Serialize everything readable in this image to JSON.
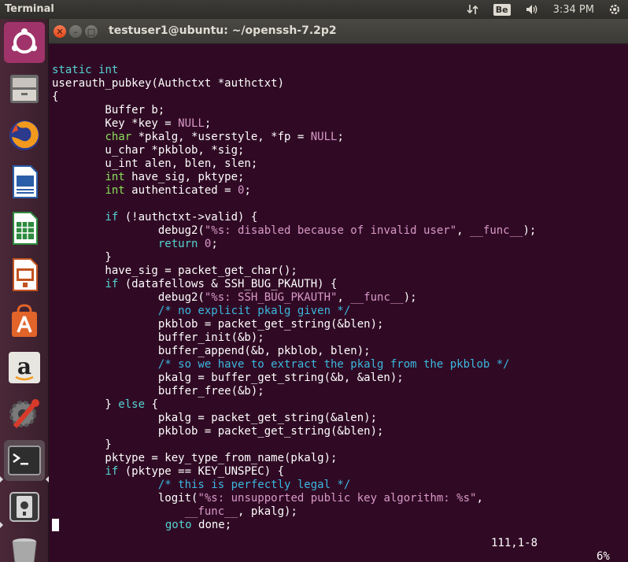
{
  "panel": {
    "app_title": "Terminal",
    "keyboard_layout": "Be",
    "clock": "3:34 PM"
  },
  "launcher": {
    "items": [
      {
        "name": "ubuntu-dash-icon"
      },
      {
        "name": "files-icon"
      },
      {
        "name": "firefox-icon"
      },
      {
        "name": "libreoffice-writer-icon"
      },
      {
        "name": "libreoffice-calc-icon"
      },
      {
        "name": "libreoffice-impress-icon"
      },
      {
        "name": "ubuntu-software-icon"
      },
      {
        "name": "amazon-icon"
      },
      {
        "name": "system-settings-icon"
      },
      {
        "name": "terminal-icon"
      },
      {
        "name": "disk-icon"
      },
      {
        "name": "trash-icon"
      }
    ]
  },
  "window": {
    "title": "testuser1@ubuntu: ~/openssh-7.2p2"
  },
  "code_lines": [
    [],
    [
      [
        "kw",
        "static"
      ],
      [
        "t",
        " "
      ],
      [
        "kw",
        "int"
      ]
    ],
    [
      [
        "t",
        "userauth_pubkey(Authctxt *authctxt)"
      ]
    ],
    [
      [
        "t",
        "{"
      ]
    ],
    [
      [
        "t",
        "        Buffer b;"
      ]
    ],
    [
      [
        "t",
        "        Key *key = "
      ],
      [
        "num",
        "NULL"
      ],
      [
        "t",
        ";"
      ]
    ],
    [
      [
        "t",
        "        "
      ],
      [
        "typ",
        "char"
      ],
      [
        "t",
        " *pkalg, *userstyle, *fp = "
      ],
      [
        "num",
        "NULL"
      ],
      [
        "t",
        ";"
      ]
    ],
    [
      [
        "t",
        "        u_char *pkblob, *sig;"
      ]
    ],
    [
      [
        "t",
        "        u_int alen, blen, slen;"
      ]
    ],
    [
      [
        "t",
        "        "
      ],
      [
        "typ",
        "int"
      ],
      [
        "t",
        " have_sig, pktype;"
      ]
    ],
    [
      [
        "t",
        "        "
      ],
      [
        "typ",
        "int"
      ],
      [
        "t",
        " authenticated = "
      ],
      [
        "num",
        "0"
      ],
      [
        "t",
        ";"
      ]
    ],
    [],
    [
      [
        "t",
        "        "
      ],
      [
        "kw",
        "if"
      ],
      [
        "t",
        " (!authctxt->valid) {"
      ]
    ],
    [
      [
        "t",
        "                debug2("
      ],
      [
        "str",
        "\"%s: disabled because of invalid user\""
      ],
      [
        "t",
        ", "
      ],
      [
        "str",
        "__func__"
      ],
      [
        "t",
        ");"
      ]
    ],
    [
      [
        "t",
        "                "
      ],
      [
        "kw",
        "return"
      ],
      [
        "t",
        " "
      ],
      [
        "num",
        "0"
      ],
      [
        "t",
        ";"
      ]
    ],
    [
      [
        "t",
        "        }"
      ]
    ],
    [
      [
        "t",
        "        have_sig = packet_get_char();"
      ]
    ],
    [
      [
        "t",
        "        "
      ],
      [
        "kw",
        "if"
      ],
      [
        "t",
        " (datafellows & SSH_BUG_PKAUTH) {"
      ]
    ],
    [
      [
        "t",
        "                debug2("
      ],
      [
        "str",
        "\"%s: SSH_BUG_PKAUTH\""
      ],
      [
        "t",
        ", "
      ],
      [
        "str",
        "__func__"
      ],
      [
        "t",
        ");"
      ]
    ],
    [
      [
        "t",
        "                "
      ],
      [
        "cmt",
        "/* no explicit pkalg given */"
      ]
    ],
    [
      [
        "t",
        "                pkblob = packet_get_string(&blen);"
      ]
    ],
    [
      [
        "t",
        "                buffer_init(&b);"
      ]
    ],
    [
      [
        "t",
        "                buffer_append(&b, pkblob, blen);"
      ]
    ],
    [
      [
        "t",
        "                "
      ],
      [
        "cmt",
        "/* so we have to extract the pkalg from the pkblob */"
      ]
    ],
    [
      [
        "t",
        "                pkalg = buffer_get_string(&b, &alen);"
      ]
    ],
    [
      [
        "t",
        "                buffer_free(&b);"
      ]
    ],
    [
      [
        "t",
        "        } "
      ],
      [
        "kw",
        "else"
      ],
      [
        "t",
        " {"
      ]
    ],
    [
      [
        "t",
        "                pkalg = packet_get_string(&alen);"
      ]
    ],
    [
      [
        "t",
        "                pkblob = packet_get_string(&blen);"
      ]
    ],
    [
      [
        "t",
        "        }"
      ]
    ],
    [
      [
        "t",
        "        pktype = key_type_from_name(pkalg);"
      ]
    ],
    [
      [
        "t",
        "        "
      ],
      [
        "kw",
        "if"
      ],
      [
        "t",
        " (pktype == KEY_UNSPEC) {"
      ]
    ],
    [
      [
        "t",
        "                "
      ],
      [
        "cmt",
        "/* this is perfectly legal */"
      ]
    ],
    [
      [
        "t",
        "                logit("
      ],
      [
        "str",
        "\"%s: unsupported public key algorithm: %s\""
      ],
      [
        "t",
        ","
      ]
    ],
    [
      [
        "t",
        "                    "
      ],
      [
        "str",
        "__func__"
      ],
      [
        "t",
        ", pkalg);"
      ]
    ],
    [
      [
        "cur",
        ""
      ],
      [
        "t",
        "       "
      ],
      [
        "t",
        "         "
      ],
      [
        "kw",
        "goto"
      ],
      [
        "t",
        " done;"
      ]
    ]
  ],
  "status": {
    "position": "111,1-8",
    "percent": "6%"
  },
  "colors": {
    "terminal_bg": "#300a24",
    "keyword": "#55d4d4",
    "type": "#8ae05a",
    "string": "#d898c8",
    "comment": "#3bb8e0"
  }
}
